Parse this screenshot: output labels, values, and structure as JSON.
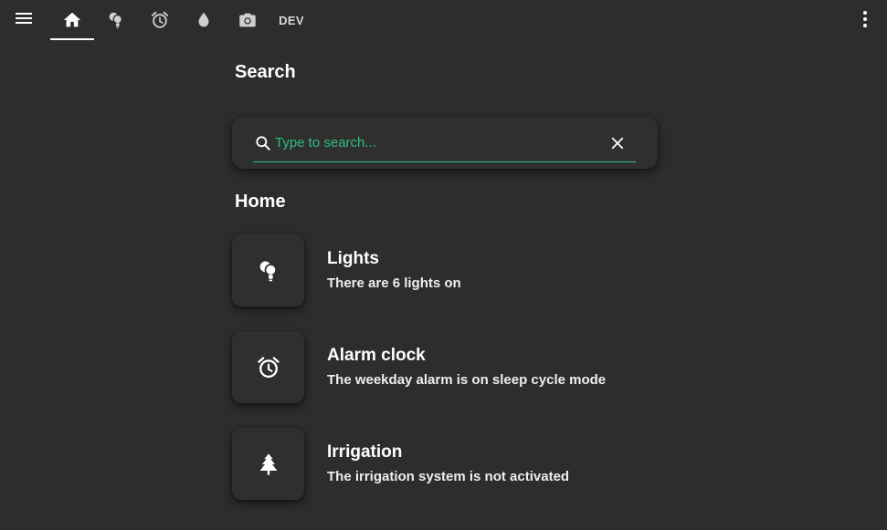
{
  "topbar": {
    "menu_icon": "hamburger-menu-icon",
    "tabs": [
      {
        "icon": "home-icon",
        "active": true
      },
      {
        "icon": "lightbulb-group-icon",
        "active": false
      },
      {
        "icon": "alarm-clock-icon",
        "active": false
      },
      {
        "icon": "water-drop-icon",
        "active": false
      },
      {
        "icon": "camera-icon",
        "active": false
      },
      {
        "label": "DEV",
        "active": false
      }
    ],
    "overflow_icon": "dots-vertical-icon"
  },
  "search": {
    "heading": "Search",
    "placeholder": "Type to search...",
    "value": "",
    "accent_color": "#2fbf7f"
  },
  "home": {
    "heading": "Home",
    "items": [
      {
        "icon": "lightbulb-group-icon",
        "title": "Lights",
        "description": "There are 6 lights on"
      },
      {
        "icon": "alarm-clock-icon",
        "title": "Alarm clock",
        "description": "The weekday alarm is on sleep cycle mode"
      },
      {
        "icon": "pine-tree-icon",
        "title": "Irrigation",
        "description": "The irrigation system is not activated"
      }
    ]
  },
  "colors": {
    "background": "#2d2d2d",
    "card": "#2f2f2f",
    "text": "#ffffff",
    "accent": "#2fbf7f"
  }
}
